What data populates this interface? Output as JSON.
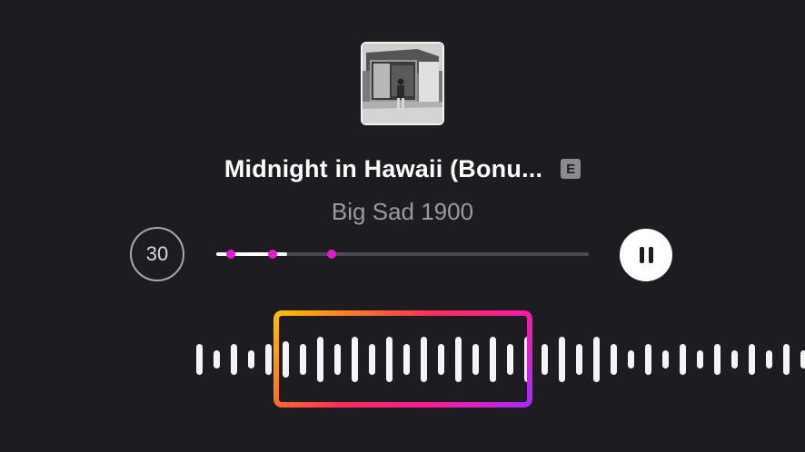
{
  "track": {
    "title": "Midnight in Hawaii (Bonu...",
    "explicit_label": "E",
    "artist": "Big Sad 1900",
    "album_art": "black-and-white photo of a man standing in front of a house"
  },
  "controls": {
    "skip_label": "30",
    "pause_icon": "pause-icon",
    "progress_fraction": 0.19,
    "marker_fractions": [
      0.04,
      0.15,
      0.31
    ]
  },
  "colors": {
    "background": "#1c1c21",
    "marker": "#e21bd1",
    "selection_gradient": [
      "#ffc400",
      "#ff2d5a",
      "#ff1c9a",
      "#a32bff"
    ]
  }
}
